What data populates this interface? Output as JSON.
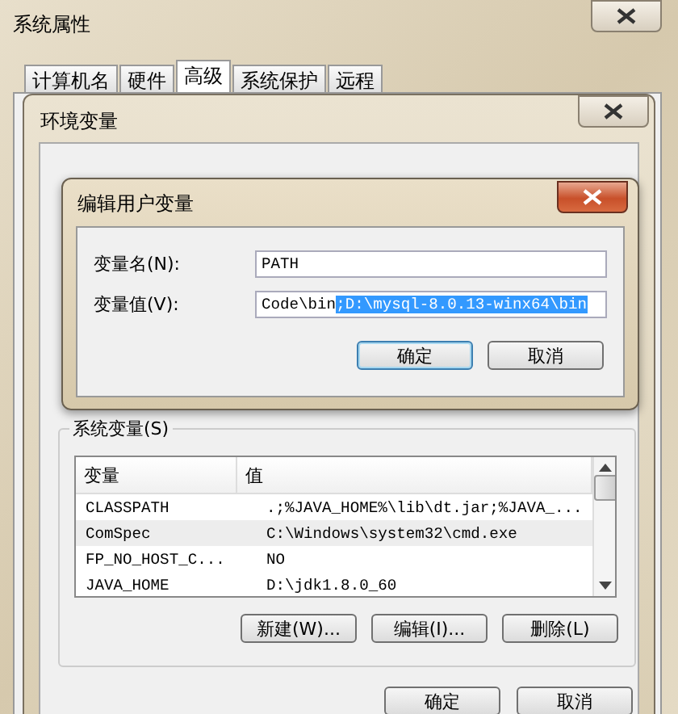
{
  "window": {
    "title": "系统属性"
  },
  "tabs": [
    {
      "label": "计算机名",
      "selected": false
    },
    {
      "label": "硬件",
      "selected": false
    },
    {
      "label": "高级",
      "selected": true
    },
    {
      "label": "系统保护",
      "selected": false
    },
    {
      "label": "远程",
      "selected": false
    }
  ],
  "env_window": {
    "title": "环境变量"
  },
  "edit_dialog": {
    "title": "编辑用户变量",
    "fields": [
      {
        "label": "变量名(N):",
        "value": "PATH"
      },
      {
        "label": "变量值(V):",
        "value": "Code\\bin",
        "selected_text": ";D:\\mysql-8.0.13-winx64\\bin"
      }
    ],
    "buttons": [
      {
        "label": "确定",
        "default": true
      },
      {
        "label": "取消",
        "default": false
      }
    ]
  },
  "system_variables": {
    "title": "系统变量(S)",
    "columns": [
      "变量",
      "值"
    ],
    "rows": [
      {
        "name": "CLASSPATH",
        "value": ".;%JAVA_HOME%\\lib\\dt.jar;%JAVA_...",
        "hovered": false
      },
      {
        "name": "ComSpec",
        "value": "C:\\Windows\\system32\\cmd.exe",
        "hovered": true
      },
      {
        "name": "FP_NO_HOST_C...",
        "value": "NO",
        "hovered": false
      },
      {
        "name": "JAVA_HOME",
        "value": "D:\\jdk1.8.0_60",
        "hovered": false
      }
    ],
    "buttons": [
      "新建(W)...",
      "编辑(I)...",
      "删除(L)"
    ]
  },
  "buttons": [
    "确定",
    "取消"
  ]
}
